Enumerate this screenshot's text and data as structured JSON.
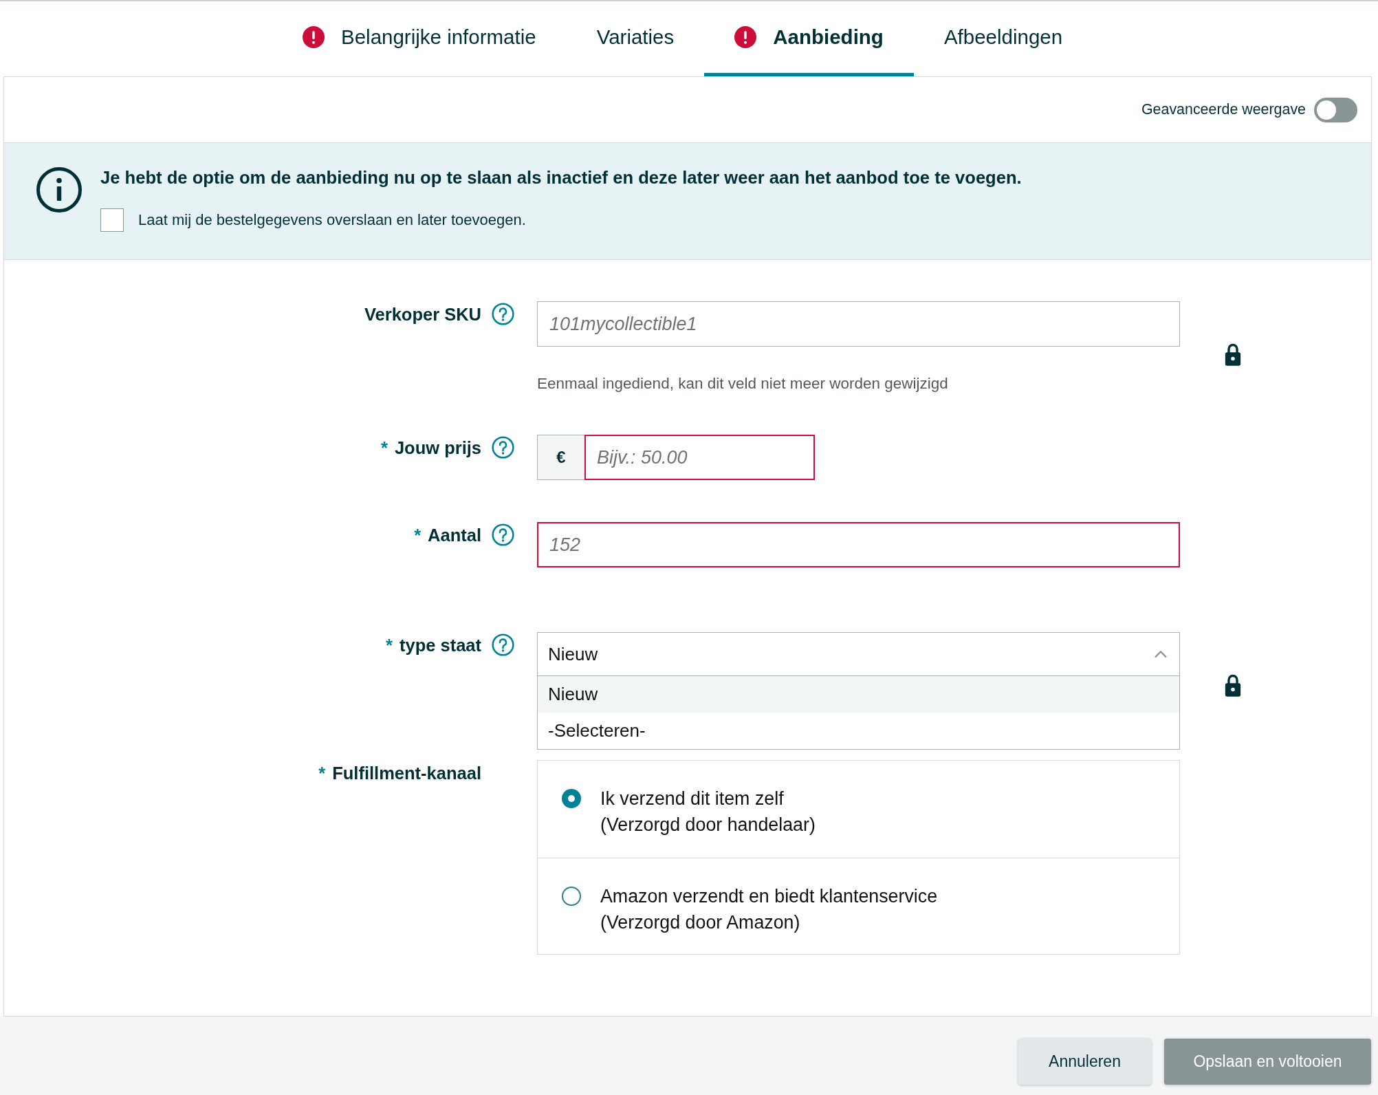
{
  "tabs": [
    {
      "label": "Belangrijke informatie",
      "selected": false,
      "error": true
    },
    {
      "label": "Variaties",
      "selected": false,
      "error": false
    },
    {
      "label": "Aanbieding",
      "selected": true,
      "error": true
    },
    {
      "label": "Afbeeldingen",
      "selected": false,
      "error": false
    }
  ],
  "advanced_view": {
    "label": "Geavanceerde weergave",
    "on": false
  },
  "info_banner": {
    "message": "Je hebt de optie om de aanbieding nu op te slaan als inactief en deze later weer aan het aanbod toe te voegen.",
    "checkbox": {
      "label": "Laat mij de bestelgegevens overslaan en later toevoegen.",
      "checked": false
    }
  },
  "form": {
    "required_mark": "*",
    "fields": [
      {
        "kind": "text",
        "label": "Verkoper SKU",
        "help": true,
        "locked": true,
        "invalid": false,
        "placeholder": "101mycollectible1",
        "hint": "Eenmaal ingediend, kan dit veld niet meer worden gewijzigd"
      },
      {
        "kind": "price",
        "label": "Jouw prijs",
        "required": true,
        "help": true,
        "invalid": true,
        "prefix": "€",
        "placeholder": "Bijv.: 50.00"
      },
      {
        "kind": "text",
        "label": "Aantal",
        "required": true,
        "help": true,
        "invalid": true,
        "placeholder": "152"
      },
      {
        "kind": "select",
        "label": "type staat",
        "required": true,
        "help": true,
        "locked": true,
        "value": "Nieuw",
        "expanded": true,
        "options": [
          {
            "label": "Nieuw",
            "selected": true
          },
          {
            "label": "-Selecteren-",
            "selected": false
          }
        ]
      },
      {
        "kind": "radio",
        "label": "Fulfillment-kanaal",
        "required": true,
        "options": [
          {
            "label": "Ik verzend dit item zelf",
            "note": "(Verzorgd door handelaar)",
            "selected": true
          },
          {
            "label": "Amazon verzendt en biedt klantenservice",
            "note": "(Verzorgd door Amazon)",
            "selected": false
          }
        ]
      }
    ]
  },
  "buttons": [
    {
      "label": "Annuleren",
      "kind": "secondary",
      "disabled": false
    },
    {
      "label": "Opslaan en voltooien",
      "kind": "primary",
      "disabled": true
    }
  ]
}
